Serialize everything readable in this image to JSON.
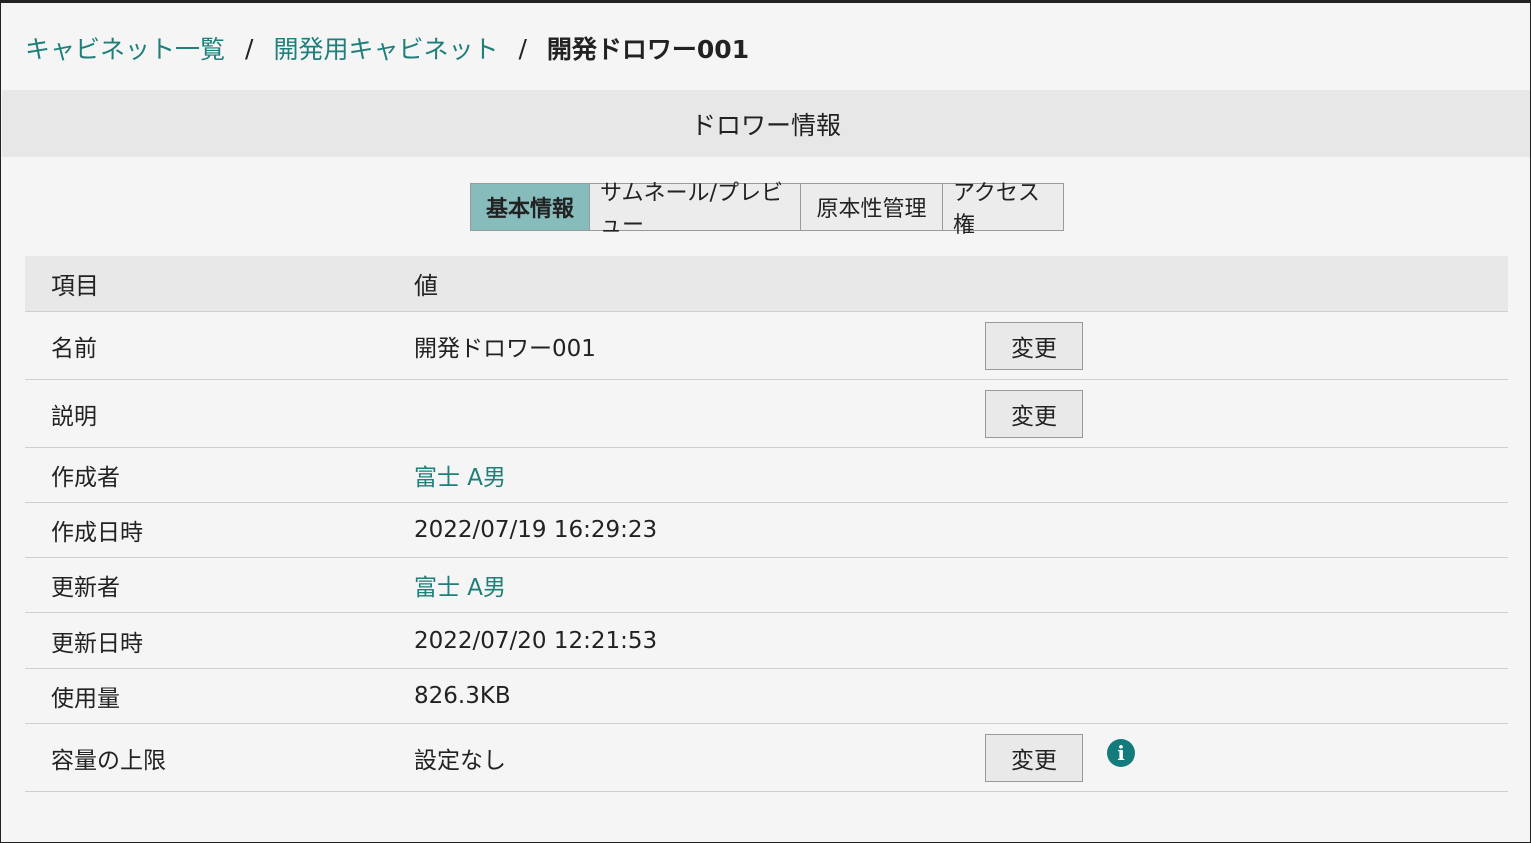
{
  "breadcrumb": {
    "items": [
      "キャビネット一覧",
      "開発用キャビネット"
    ],
    "separator": "/",
    "current": "開発ドロワー001"
  },
  "section": {
    "title": "ドロワー情報"
  },
  "tabs": [
    {
      "label": "基本情報",
      "active": true
    },
    {
      "label": "サムネール/プレビュー",
      "active": false
    },
    {
      "label": "原本性管理",
      "active": false
    },
    {
      "label": "アクセス権",
      "active": false
    }
  ],
  "table": {
    "headers": {
      "key": "項目",
      "value": "値"
    },
    "rows": [
      {
        "key": "名前",
        "value": "開発ドロワー001",
        "action": "変更"
      },
      {
        "key": "説明",
        "value": "",
        "action": "変更"
      },
      {
        "key": "作成者",
        "value": "富士 A男"
      },
      {
        "key": "作成日時",
        "value": "2022/07/19 16:29:23"
      },
      {
        "key": "更新者",
        "value": "富士 A男"
      },
      {
        "key": "更新日時",
        "value": "2022/07/20 12:21:53"
      },
      {
        "key": "使用量",
        "value": "826.3KB"
      },
      {
        "key": "容量の上限",
        "value": "設定なし",
        "action": "変更",
        "info_icon": "i"
      }
    ]
  },
  "colors": {
    "link": "#1f7f7a",
    "active_tab": "#86bcbc",
    "info_icon": "#137b7b",
    "header_bg": "#e7e7e7"
  }
}
